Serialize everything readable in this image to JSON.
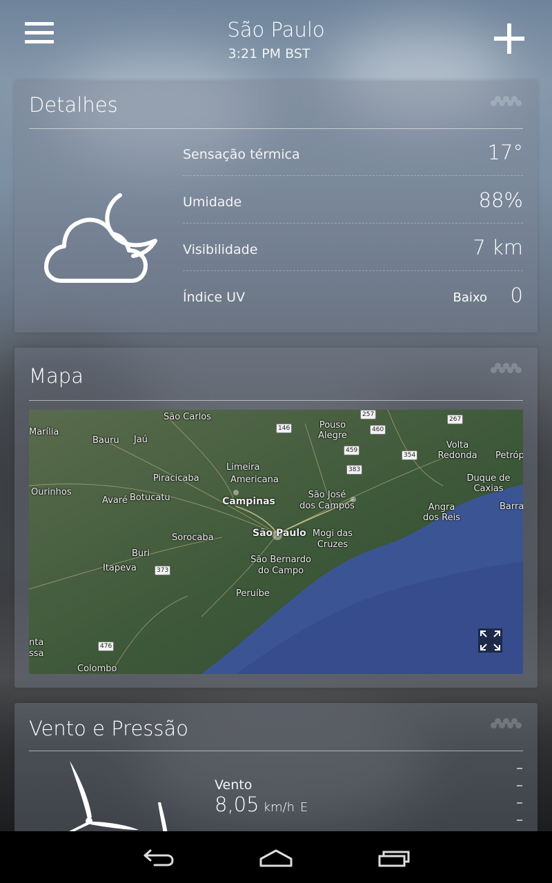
{
  "header": {
    "city": "São Paulo",
    "time": "3:21 PM BST"
  },
  "details": {
    "title": "Detalhes",
    "icon": "cloud-moon-icon",
    "rows": [
      {
        "label": "Sensação térmica",
        "value": "17°"
      },
      {
        "label": "Umidade",
        "value": "88%"
      },
      {
        "label": "Visibilidade",
        "value": "7 km"
      },
      {
        "label": "Índice UV",
        "qualifier": "Baixo",
        "value": "0"
      }
    ]
  },
  "map": {
    "title": "Mapa",
    "places": [
      "São Carlos",
      "Marília",
      "Bauru",
      "Jaú",
      "Pouso Alegre",
      "Volta Redonda",
      "Petróp",
      "Limeira",
      "Piracicaba",
      "Americana",
      "Duque de Caxias",
      "Ourinhos",
      "Avaré",
      "Botucatu",
      "Campinas",
      "São José dos Campos",
      "Angra dos Reis",
      "Barra",
      "Sorocaba",
      "São Paulo",
      "Mogi das Cruzes",
      "Buri",
      "Itapeva",
      "São Bernardo do Campo",
      "Peruíbe",
      "nta",
      "ssa",
      "Colombo"
    ],
    "shields": [
      "257",
      "267",
      "146",
      "460",
      "459",
      "354",
      "383",
      "373",
      "476"
    ],
    "expand_icon": "expand-icon"
  },
  "wind": {
    "title": "Vento e Pressão",
    "label": "Vento",
    "speed": "8,05",
    "unit": "km/h",
    "direction": "E",
    "icon": "wind-turbine-icon"
  },
  "navbar": {
    "back": "back-icon",
    "home": "home-icon",
    "recents": "recents-icon"
  }
}
